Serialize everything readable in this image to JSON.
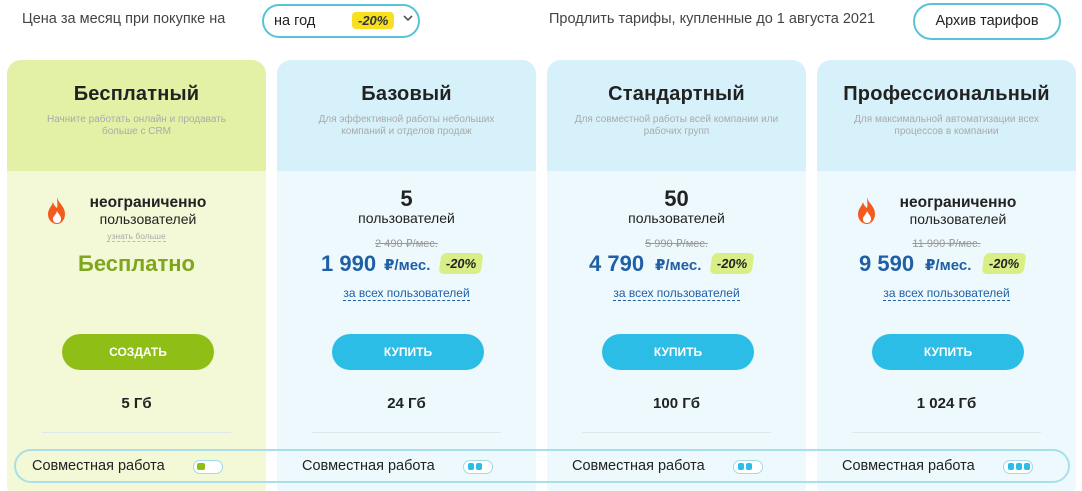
{
  "topbar": {
    "period_label": "Цена за месяц при покупке на",
    "period_value": "на год",
    "period_discount": "-20%",
    "renew_label": "Продлить тарифы, купленные до 1 августа 2021",
    "archive_label": "Архив тарифов"
  },
  "colors": {
    "accent": "#55c4d8",
    "free_green": "#8fbf17",
    "cta_blue": "#2cbde6",
    "price_blue": "#1f5fa6",
    "discount_yellow": "#f6e020",
    "discount_lime": "#d9ef86"
  },
  "plans": [
    {
      "name": "Бесплатный",
      "desc": "Начните работать онлайн и продавать больше с CRM",
      "users_title": "неограниченно",
      "users_sub": "пользователей",
      "learn_more": "узнать больше",
      "price_free": "Бесплатно",
      "cta": "СОЗДАТЬ",
      "storage": "5 Гб",
      "collab": "Совместная работа",
      "collab_level": 1
    },
    {
      "name": "Базовый",
      "desc": "Для эффективной работы небольших компаний и отделов продаж",
      "users_count": "5",
      "users_sub": "пользователей",
      "old_price": "2 490 ₽/мес.",
      "price": "1 990",
      "price_unit": "₽/мес.",
      "discount": "-20%",
      "per_all": "за всех пользователей",
      "cta": "КУПИТЬ",
      "storage": "24 Гб",
      "collab": "Совместная работа",
      "collab_level": 2
    },
    {
      "name": "Стандартный",
      "desc": "Для совместной работы всей компании или рабочих групп",
      "users_count": "50",
      "users_sub": "пользователей",
      "old_price": "5 990 ₽/мес.",
      "price": "4 790",
      "price_unit": "₽/мес.",
      "discount": "-20%",
      "per_all": "за всех пользователей",
      "cta": "КУПИТЬ",
      "storage": "100 Гб",
      "collab": "Совместная работа",
      "collab_level": 2
    },
    {
      "name": "Профессиональный",
      "desc": "Для максимальной автоматизации всех процессов в компании",
      "users_title": "неограниченно",
      "users_sub": "пользователей",
      "old_price": "11 990 ₽/мес.",
      "price": "9 590",
      "price_unit": "₽/мес.",
      "discount": "-20%",
      "per_all": "за всех пользователей",
      "cta": "КУПИТЬ",
      "storage": "1 024 Гб",
      "collab": "Совместная работа",
      "collab_level": 3
    }
  ],
  "icons": {
    "flame": "flame-icon",
    "chevron": "chevron-down-icon"
  }
}
